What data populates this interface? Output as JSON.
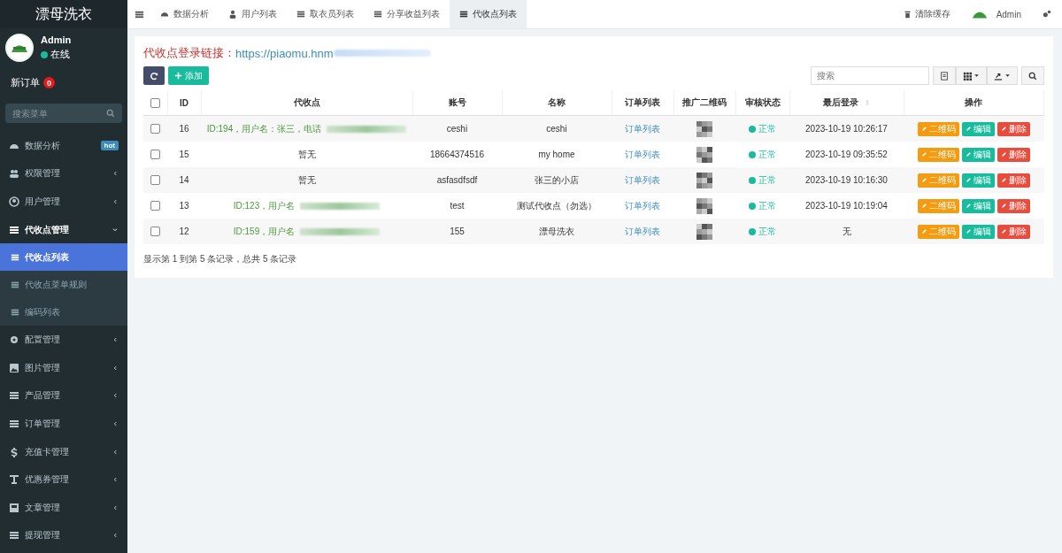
{
  "sidebar": {
    "brand": "漂母洗衣",
    "user": {
      "name": "Admin",
      "status": "在线"
    },
    "new_orders": {
      "label": "新订单",
      "count": "0"
    },
    "search": {
      "placeholder": "搜索菜单"
    },
    "items": [
      {
        "label": "数据分析",
        "badge": "hot",
        "expanded": false,
        "has_children": false
      },
      {
        "label": "权限管理",
        "expanded": false,
        "has_children": true
      },
      {
        "label": "用户管理",
        "expanded": false,
        "has_children": true
      },
      {
        "label": "代收点管理",
        "expanded": true,
        "has_children": true,
        "children": [
          {
            "label": "代收点列表",
            "selected": true
          },
          {
            "label": "代收点菜单规则",
            "selected": false
          },
          {
            "label": "编码列表",
            "selected": false
          }
        ]
      },
      {
        "label": "配置管理",
        "expanded": false,
        "has_children": true
      },
      {
        "label": "图片管理",
        "expanded": false,
        "has_children": true
      },
      {
        "label": "产品管理",
        "expanded": false,
        "has_children": true
      },
      {
        "label": "订单管理",
        "expanded": false,
        "has_children": true
      },
      {
        "label": "充值卡管理",
        "expanded": false,
        "has_children": true
      },
      {
        "label": "优惠券管理",
        "expanded": false,
        "has_children": true
      },
      {
        "label": "文章管理",
        "expanded": false,
        "has_children": true
      },
      {
        "label": "提现管理",
        "expanded": false,
        "has_children": true
      }
    ]
  },
  "tabs": [
    {
      "label": "数据分析",
      "selected": false
    },
    {
      "label": "用户列表",
      "selected": false
    },
    {
      "label": "取衣员列表",
      "selected": false
    },
    {
      "label": "分享收益列表",
      "selected": false
    },
    {
      "label": "代收点列表",
      "selected": true
    }
  ],
  "header_right": {
    "clear_cache": "清除缓存",
    "user": "Admin"
  },
  "login_link": {
    "label": "代收点登录链接：",
    "url": "https://piaomu.hnm"
  },
  "toolbar": {
    "add": "添加",
    "search": {
      "placeholder": "搜索"
    }
  },
  "table": {
    "select_all_checked": false,
    "columns": [
      {
        "label": "ID"
      },
      {
        "label": "代收点"
      },
      {
        "label": "账号"
      },
      {
        "label": "名称"
      },
      {
        "label": "订单列表"
      },
      {
        "label": "推广二维码"
      },
      {
        "label": "审核状态"
      },
      {
        "label": "最后登录",
        "sortable": true
      },
      {
        "label": "操作"
      }
    ],
    "rows": [
      {
        "id": "16",
        "point": "ID:194，用户名：张三，电话",
        "point_redacted": true,
        "account": "ceshi",
        "name": "ceshi",
        "orders": "订单列表",
        "status": "正常",
        "last_login": "2023-10-19 10:26:17",
        "checked": false,
        "actions": [
          {
            "label": "二维码",
            "kind": "warning"
          },
          {
            "label": "编辑",
            "kind": "success"
          },
          {
            "label": "删除",
            "kind": "danger"
          }
        ]
      },
      {
        "id": "15",
        "point": "暂无",
        "point_redacted": false,
        "account": "18664374516",
        "name": "my home",
        "orders": "订单列表",
        "status": "正常",
        "last_login": "2023-10-19 09:35:52",
        "checked": false,
        "actions": [
          {
            "label": "二维码",
            "kind": "warning"
          },
          {
            "label": "编辑",
            "kind": "success"
          },
          {
            "label": "删除",
            "kind": "danger"
          }
        ]
      },
      {
        "id": "14",
        "point": "暂无",
        "point_redacted": false,
        "account": "asfasdfsdf",
        "name": "张三的小店",
        "orders": "订单列表",
        "status": "正常",
        "last_login": "2023-10-19 10:16:30",
        "checked": false,
        "actions": [
          {
            "label": "二维码",
            "kind": "warning"
          },
          {
            "label": "编辑",
            "kind": "success"
          },
          {
            "label": "删除",
            "kind": "danger"
          }
        ]
      },
      {
        "id": "13",
        "point": "ID:123，用户名",
        "point_redacted": true,
        "account": "test",
        "name": "测试代收点（勿选）",
        "orders": "订单列表",
        "status": "正常",
        "last_login": "2023-10-19 10:19:04",
        "checked": false,
        "actions": [
          {
            "label": "二维码",
            "kind": "warning"
          },
          {
            "label": "编辑",
            "kind": "success"
          },
          {
            "label": "删除",
            "kind": "danger"
          }
        ]
      },
      {
        "id": "12",
        "point": "ID:159，用户名",
        "point_redacted": true,
        "account": "155",
        "name": "漂母洗衣",
        "orders": "订单列表",
        "status": "正常",
        "last_login": "无",
        "checked": false,
        "actions": [
          {
            "label": "二维码",
            "kind": "warning"
          },
          {
            "label": "编辑",
            "kind": "success"
          },
          {
            "label": "删除",
            "kind": "danger"
          }
        ]
      }
    ]
  },
  "pagination_info": "显示第 1 到第 5 条记录，总共 5 条记录"
}
